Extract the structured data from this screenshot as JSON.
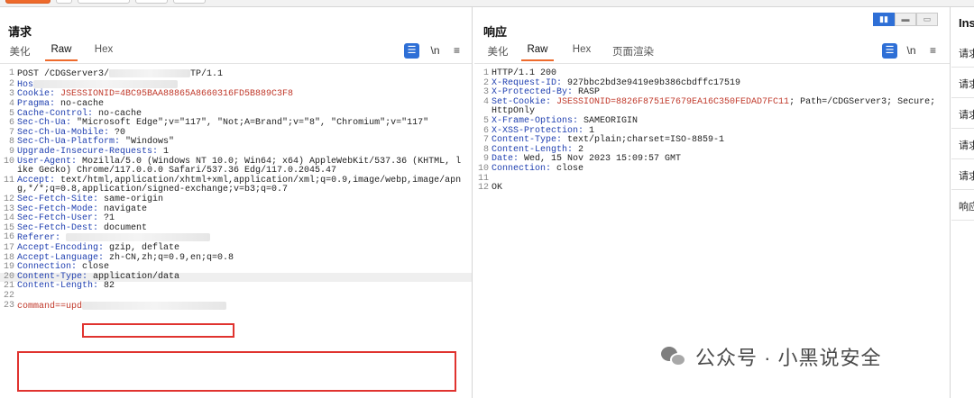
{
  "request": {
    "title": "请求",
    "tabs": [
      "美化",
      "Raw",
      "Hex"
    ],
    "active_tab": "Raw",
    "tools": {
      "wrap": "☰",
      "newline": "\\n",
      "menu": "≡"
    },
    "lines": [
      {
        "n": "1",
        "k": "",
        "v": "POST /CDGServer3/",
        "redact": "tail",
        "tail": "TP/1.1"
      },
      {
        "n": "2",
        "k": "Hos",
        "v": "",
        "redact": "after"
      },
      {
        "n": "3",
        "k": "Cookie: ",
        "v": "JSESSIONID=4BC95BAA88865A8660316FD5B889C3F8",
        "cookie": true
      },
      {
        "n": "4",
        "k": "Pragma: ",
        "v": "no-cache"
      },
      {
        "n": "5",
        "k": "Cache-Control: ",
        "v": "no-cache"
      },
      {
        "n": "6",
        "k": "Sec-Ch-Ua: ",
        "v": "\"Microsoft Edge\";v=\"117\", \"Not;A=Brand\";v=\"8\", \"Chromium\";v=\"117\""
      },
      {
        "n": "7",
        "k": "Sec-Ch-Ua-Mobile: ",
        "v": "?0"
      },
      {
        "n": "8",
        "k": "Sec-Ch-Ua-Platform: ",
        "v": "\"Windows\""
      },
      {
        "n": "9",
        "k": "Upgrade-Insecure-Requests: ",
        "v": "1"
      },
      {
        "n": "10",
        "k": "User-Agent: ",
        "v": "Mozilla/5.0 (Windows NT 10.0; Win64; x64) AppleWebKit/537.36 (KHTML, like Gecko) Chrome/117.0.0.0 Safari/537.36 Edg/117.0.2045.47"
      },
      {
        "n": "11",
        "k": "Accept:",
        "v": " text/html,application/xhtml+xml,application/xml;q=0.9,image/webp,image/apng,*/*;q=0.8,application/signed-exchange;v=b3;q=0.7"
      },
      {
        "n": "12",
        "k": "Sec-Fetch-Site: ",
        "v": "same-origin"
      },
      {
        "n": "13",
        "k": "Sec-Fetch-Mode: ",
        "v": "navigate"
      },
      {
        "n": "14",
        "k": "Sec-Fetch-User: ",
        "v": "?1"
      },
      {
        "n": "15",
        "k": "Sec-Fetch-Dest: ",
        "v": "document"
      },
      {
        "n": "16",
        "k": "Referer: ",
        "v": "",
        "redact": "after"
      },
      {
        "n": "17",
        "k": "Accept-Encoding: ",
        "v": "gzip, deflate"
      },
      {
        "n": "18",
        "k": "Accept-Language: ",
        "v": "zh-CN,zh;q=0.9,en;q=0.8"
      },
      {
        "n": "19",
        "k": "Connection: ",
        "v": "close"
      },
      {
        "n": "20",
        "k": "Content-Type: ",
        "v": "application/data",
        "hl": true
      },
      {
        "n": "21",
        "k": "Content-Length: ",
        "v": "82"
      },
      {
        "n": "22",
        "k": "",
        "v": ""
      },
      {
        "n": "23",
        "k": "",
        "v": "command==upd",
        "cookie": true,
        "redact": "after"
      }
    ]
  },
  "response": {
    "title": "响应",
    "tabs": [
      "美化",
      "Raw",
      "Hex",
      "页面渲染"
    ],
    "active_tab": "Raw",
    "view_buttons": [
      "▮▮",
      "▬",
      "▭"
    ],
    "lines": [
      {
        "n": "1",
        "k": "",
        "v": "HTTP/1.1 200"
      },
      {
        "n": "2",
        "k": "X-Request-ID: ",
        "v": "927bbc2bd3e9419e9b386cbdffc17519"
      },
      {
        "n": "3",
        "k": "X-Protected-By: ",
        "v": "RASP"
      },
      {
        "n": "4",
        "k": "Set-Cookie: ",
        "v": "JSESSIONID=8826F8751E7679EA16C350FEDAD7FC11",
        "cookie": true,
        "tail": "; Path=/CDGServer3; Secure; HttpOnly"
      },
      {
        "n": "5",
        "k": "X-Frame-Options: ",
        "v": "SAMEORIGIN"
      },
      {
        "n": "6",
        "k": "X-XSS-Protection: ",
        "v": "1"
      },
      {
        "n": "7",
        "k": "Content-Type: ",
        "v": "text/plain;charset=ISO-8859-1"
      },
      {
        "n": "8",
        "k": "Content-Length: ",
        "v": "2"
      },
      {
        "n": "9",
        "k": "Date: ",
        "v": "Wed, 15 Nov 2023 15:09:57 GMT"
      },
      {
        "n": "10",
        "k": "Connection: ",
        "v": "close"
      },
      {
        "n": "11",
        "k": "",
        "v": ""
      },
      {
        "n": "12",
        "k": "",
        "v": "OK"
      }
    ]
  },
  "inspector": {
    "title": "Ins",
    "items": [
      "请求",
      "请求",
      "请求",
      "请求",
      "请求",
      "响应"
    ]
  },
  "watermark": "公众号 · 小黑说安全",
  "colors": {
    "accent": "#ee6a2c",
    "header_key": "#1f3fb0",
    "cookie_value": "#c0392b",
    "highlight_box": "#e0332f",
    "tool_blue": "#2e6fd6"
  }
}
